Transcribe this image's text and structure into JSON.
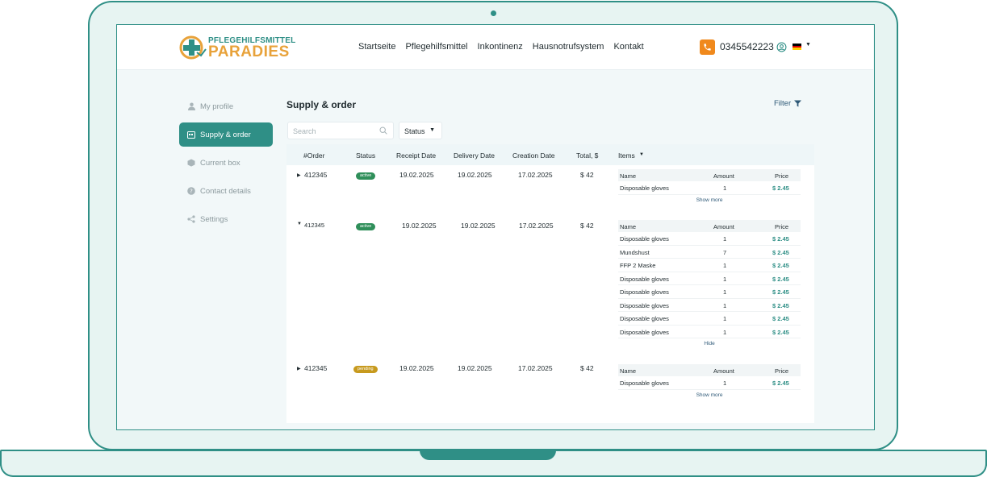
{
  "brand": {
    "top": "PFLEGEHILFSMITTEL",
    "main": "PARADIES",
    "teal": "#2f8f86",
    "orange": "#e8a23a"
  },
  "nav": [
    "Startseite",
    "Pflegehilfsmittel",
    "Inkontinenz",
    "Hausnotrufsystem",
    "Kontakt"
  ],
  "phone": "0345542223",
  "sidebar": [
    {
      "label": "My profile",
      "icon": "user-icon"
    },
    {
      "label": "Supply & order",
      "icon": "calendar-icon",
      "active": true
    },
    {
      "label": "Current box",
      "icon": "box-icon"
    },
    {
      "label": "Contact details",
      "icon": "question-icon"
    },
    {
      "label": "Settings",
      "icon": "share-icon"
    }
  ],
  "page_title": "Supply & order",
  "filter_label": "Filter",
  "search_placeholder": "Search",
  "status_label": "Status",
  "columns": [
    "#Order",
    "Status",
    "Receipt Date",
    "Delivery Date",
    "Creation Date",
    "Total, $",
    "Items"
  ],
  "items_columns": [
    "Name",
    "Amount",
    "Price"
  ],
  "orders": [
    {
      "id": "412345",
      "status": "active",
      "receipt": "19.02.2025",
      "delivery": "19.02.2025",
      "creation": "17.02.2025",
      "total": "$ 42",
      "items": [
        {
          "name": "Disposable gloves",
          "amount": "1",
          "price": "$ 2.45"
        }
      ],
      "toggle": "Show more"
    },
    {
      "id": "412345",
      "status": "active",
      "receipt": "19.02.2025",
      "delivery": "19.02.2025",
      "creation": "17.02.2025",
      "total": "$ 42",
      "items": [
        {
          "name": "Disposable gloves",
          "amount": "1",
          "price": "$ 2.45"
        },
        {
          "name": "Mundshust",
          "amount": "7",
          "price": "$ 2.45"
        },
        {
          "name": "FFP 2 Maske",
          "amount": "1",
          "price": "$ 2.45"
        },
        {
          "name": "Disposable gloves",
          "amount": "1",
          "price": "$ 2.45"
        },
        {
          "name": "Disposable gloves",
          "amount": "1",
          "price": "$ 2.45"
        },
        {
          "name": "Disposable gloves",
          "amount": "1",
          "price": "$ 2.45"
        },
        {
          "name": "Disposable gloves",
          "amount": "1",
          "price": "$ 2.45"
        },
        {
          "name": "Disposable gloves",
          "amount": "1",
          "price": "$ 2.45"
        }
      ],
      "toggle": "Hide"
    },
    {
      "id": "412345",
      "status": "pending",
      "receipt": "19.02.2025",
      "delivery": "19.02.2025",
      "creation": "17.02.2025",
      "total": "$ 42",
      "items": [
        {
          "name": "Disposable gloves",
          "amount": "1",
          "price": "$ 2.45"
        }
      ],
      "toggle": "Show more"
    }
  ]
}
